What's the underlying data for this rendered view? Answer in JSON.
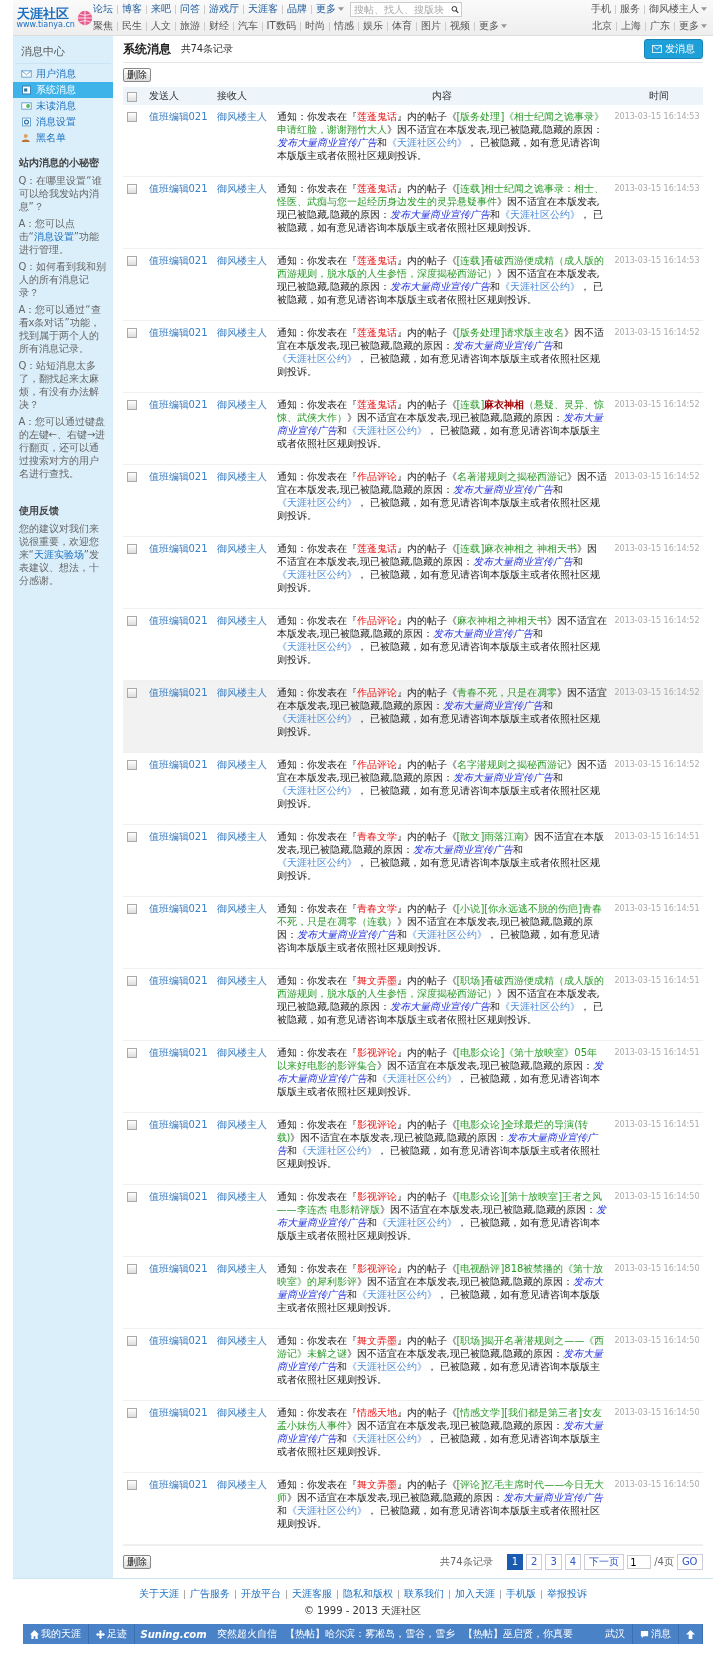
{
  "header": {
    "logo": {
      "title": "天涯社区",
      "url": "www.tianya.cn"
    },
    "nav_primary": [
      {
        "label": "论坛",
        "dropdown": false
      },
      {
        "label": "博客",
        "dropdown": false
      },
      {
        "label": "来吧",
        "dropdown": false
      },
      {
        "label": "问答",
        "dropdown": false
      },
      {
        "label": "游戏厅",
        "dropdown": false
      },
      {
        "label": "天涯客",
        "dropdown": false
      },
      {
        "label": "品牌",
        "dropdown": false
      },
      {
        "label": "更多",
        "dropdown": true
      }
    ],
    "search": {
      "placeholder": "搜帖、找人、搜版块"
    },
    "user_links": [
      {
        "label": "手机",
        "dropdown": false
      },
      {
        "label": "服务",
        "dropdown": false
      },
      {
        "label": "御风楼主人",
        "dropdown": true
      }
    ],
    "nav_secondary": [
      {
        "label": "聚焦",
        "dropdown": false
      },
      {
        "label": "民生",
        "dropdown": false
      },
      {
        "label": "人文",
        "dropdown": false
      },
      {
        "label": "旅游",
        "dropdown": false
      },
      {
        "label": "财经",
        "dropdown": false
      },
      {
        "label": "汽车",
        "dropdown": false
      },
      {
        "label": "IT数码",
        "dropdown": false
      },
      {
        "label": "时尚",
        "dropdown": false
      },
      {
        "label": "情感",
        "dropdown": false
      },
      {
        "label": "娱乐",
        "dropdown": false
      },
      {
        "label": "体育",
        "dropdown": false
      },
      {
        "label": "图片",
        "dropdown": false
      },
      {
        "label": "视频",
        "dropdown": false
      },
      {
        "label": "更多",
        "dropdown": true
      }
    ],
    "city_links": [
      {
        "label": "北京",
        "dropdown": false
      },
      {
        "label": "上海",
        "dropdown": false
      },
      {
        "label": "广东",
        "dropdown": false
      },
      {
        "label": "更多",
        "dropdown": true
      }
    ]
  },
  "sidebar": {
    "title": "消息中心",
    "items": [
      {
        "label": "用户消息",
        "kind": "mail",
        "selected": false
      },
      {
        "label": "系统消息",
        "kind": "system",
        "selected": true
      },
      {
        "label": "未读消息",
        "kind": "unread",
        "selected": false
      },
      {
        "label": "消息设置",
        "kind": "settings",
        "selected": false
      },
      {
        "label": "黑名单",
        "kind": "blacklist",
        "selected": false
      }
    ],
    "tips_title": "站内消息的小秘密",
    "tips": [
      [
        {
          "kind": "text",
          "text": "Q：在哪里设置“谁可以给我发站内消息”？"
        }
      ],
      [
        {
          "kind": "text",
          "text": "A：您可以点击“"
        },
        {
          "kind": "link",
          "text": "消息设置"
        },
        {
          "kind": "text",
          "text": "”功能进行管理。"
        }
      ],
      [
        {
          "kind": "text",
          "text": "Q：如何看到我和别人的所有消息记录？"
        }
      ],
      [
        {
          "kind": "text",
          "text": "A：您可以通过“查看x条对话”功能，找到属于两个人的所有消息记录。"
        }
      ],
      [
        {
          "kind": "text",
          "text": "Q：站短消息太多了，翻找起来太麻烦，有没有办法解决？"
        }
      ],
      [
        {
          "kind": "text",
          "text": "A：您可以通过键盘的左键←、右键→进行翻页，还可以通过搜索对方的用户名进行查找。"
        }
      ]
    ],
    "feedback_title": "使用反馈",
    "feedback": [
      {
        "kind": "text",
        "text": "您的建议对我们来说很重要，欢迎您来“"
      },
      {
        "kind": "link",
        "text": "天涯实验场"
      },
      {
        "kind": "text",
        "text": "”发表建议、想法，十分感谢。"
      }
    ]
  },
  "main": {
    "title": "系统消息",
    "count": "共74条记录",
    "compose_button": "发消息",
    "delete_button": "删除",
    "table": {
      "select_all_checked": false,
      "columns": [
        "发送人",
        "接收人",
        "内容",
        "时间"
      ],
      "rows": [
        {
          "checked": false,
          "highlighted": false,
          "sender": "值班编辑021",
          "receiver": "御风楼主人",
          "time": "2013-03-15 16:14:53",
          "notice": [
            {
              "kind": "plain",
              "text": "通知：你发表在『"
            },
            {
              "kind": "board",
              "text": "莲蓬鬼话"
            },
            {
              "kind": "plain",
              "text": "』内的帖子《"
            },
            {
              "kind": "post",
              "text": "[版务处理]《相士纪闻之诡事录》申请红脸，谢谢翔竹大人"
            },
            {
              "kind": "plain",
              "text": "》因不适宜在本版发表,现已被隐藏,隐藏的原因："
            },
            {
              "kind": "reason",
              "text": "发布大量商业宣传广告"
            },
            {
              "kind": "plain",
              "text": "和"
            },
            {
              "kind": "rule",
              "text": "《天涯社区公约》"
            },
            {
              "kind": "plain",
              "text": "， 已被隐藏，如有意见请咨询本版版主或者依照社区规则投诉。"
            }
          ]
        },
        {
          "checked": false,
          "highlighted": false,
          "sender": "值班编辑021",
          "receiver": "御风楼主人",
          "time": "2013-03-15 16:14:53",
          "notice": [
            {
              "kind": "plain",
              "text": "通知：你发表在『"
            },
            {
              "kind": "board",
              "text": "莲蓬鬼话"
            },
            {
              "kind": "plain",
              "text": "』内的帖子《"
            },
            {
              "kind": "post",
              "text": "[连载]相士纪闻之诡事录：相士、怪医、武痴与您一起经历身边发生的灵异悬疑事件"
            },
            {
              "kind": "plain",
              "text": "》因不适宜在本版发表,现已被隐藏,隐藏的原因："
            },
            {
              "kind": "reason",
              "text": "发布大量商业宣传广告"
            },
            {
              "kind": "plain",
              "text": "和"
            },
            {
              "kind": "rule",
              "text": "《天涯社区公约》"
            },
            {
              "kind": "plain",
              "text": "， 已被隐藏，如有意见请咨询本版版主或者依照社区规则投诉。"
            }
          ]
        },
        {
          "checked": false,
          "highlighted": false,
          "sender": "值班编辑021",
          "receiver": "御风楼主人",
          "time": "2013-03-15 16:14:53",
          "notice": [
            {
              "kind": "plain",
              "text": "通知：你发表在『"
            },
            {
              "kind": "board",
              "text": "莲蓬鬼话"
            },
            {
              "kind": "plain",
              "text": "』内的帖子《"
            },
            {
              "kind": "post",
              "text": "[连载]看破西游便成精（成人版的西游规则，脱水版的人生参悟，深度揭秘西游记）"
            },
            {
              "kind": "plain",
              "text": "》因不适宜在本版发表,现已被隐藏,隐藏的原因："
            },
            {
              "kind": "reason",
              "text": "发布大量商业宣传广告"
            },
            {
              "kind": "plain",
              "text": "和"
            },
            {
              "kind": "rule",
              "text": "《天涯社区公约》"
            },
            {
              "kind": "plain",
              "text": "， 已被隐藏，如有意见请咨询本版版主或者依照社区规则投诉。"
            }
          ]
        },
        {
          "checked": false,
          "highlighted": false,
          "sender": "值班编辑021",
          "receiver": "御风楼主人",
          "time": "2013-03-15 16:14:52",
          "notice": [
            {
              "kind": "plain",
              "text": "通知：你发表在『"
            },
            {
              "kind": "board",
              "text": "莲蓬鬼话"
            },
            {
              "kind": "plain",
              "text": "』内的帖子《"
            },
            {
              "kind": "post",
              "text": "[版务处理]请求版主改名"
            },
            {
              "kind": "plain",
              "text": "》因不适宜在本版发表,现已被隐藏,隐藏的原因："
            },
            {
              "kind": "reason",
              "text": "发布大量商业宣传广告"
            },
            {
              "kind": "plain",
              "text": "和"
            },
            {
              "kind": "rule",
              "text": "《天涯社区公约》"
            },
            {
              "kind": "plain",
              "text": "， 已被隐藏，如有意见请咨询本版版主或者依照社区规则投诉。"
            }
          ]
        },
        {
          "checked": false,
          "highlighted": false,
          "sender": "值班编辑021",
          "receiver": "御风楼主人",
          "time": "2013-03-15 16:14:52",
          "notice": [
            {
              "kind": "plain",
              "text": "通知：你发表在『"
            },
            {
              "kind": "board",
              "text": "莲蓬鬼话"
            },
            {
              "kind": "plain",
              "text": "』内的帖子《"
            },
            {
              "kind": "post",
              "text": "[连载]"
            },
            {
              "kind": "highlight",
              "text": "麻衣神相"
            },
            {
              "kind": "post",
              "text": "（悬疑、灵异、惊悚、武侠大作）"
            },
            {
              "kind": "plain",
              "text": "》因不适宜在本版发表,现已被隐藏,隐藏的原因："
            },
            {
              "kind": "reason",
              "text": "发布大量商业宣传广告"
            },
            {
              "kind": "plain",
              "text": "和"
            },
            {
              "kind": "rule",
              "text": "《天涯社区公约》"
            },
            {
              "kind": "plain",
              "text": "， 已被隐藏，如有意见请咨询本版版主或者依照社区规则投诉。"
            }
          ]
        },
        {
          "checked": false,
          "highlighted": false,
          "sender": "值班编辑021",
          "receiver": "御风楼主人",
          "time": "2013-03-15 16:14:52",
          "notice": [
            {
              "kind": "plain",
              "text": "通知：你发表在『"
            },
            {
              "kind": "board",
              "text": "作品评论"
            },
            {
              "kind": "plain",
              "text": "』内的帖子《"
            },
            {
              "kind": "post",
              "text": "名著潜规则之揭秘西游记"
            },
            {
              "kind": "plain",
              "text": "》因不适宜在本版发表,现已被隐藏,隐藏的原因："
            },
            {
              "kind": "reason",
              "text": "发布大量商业宣传广告"
            },
            {
              "kind": "plain",
              "text": "和"
            },
            {
              "kind": "rule",
              "text": "《天涯社区公约》"
            },
            {
              "kind": "plain",
              "text": "， 已被隐藏，如有意见请咨询本版版主或者依照社区规则投诉。"
            }
          ]
        },
        {
          "checked": false,
          "highlighted": false,
          "sender": "值班编辑021",
          "receiver": "御风楼主人",
          "time": "2013-03-15 16:14:52",
          "notice": [
            {
              "kind": "plain",
              "text": "通知：你发表在『"
            },
            {
              "kind": "board",
              "text": "莲蓬鬼话"
            },
            {
              "kind": "plain",
              "text": "』内的帖子《"
            },
            {
              "kind": "post",
              "text": "[连载]麻衣神相之 神相天书"
            },
            {
              "kind": "plain",
              "text": "》因不适宜在本版发表,现已被隐藏,隐藏的原因："
            },
            {
              "kind": "reason",
              "text": "发布大量商业宣传广告"
            },
            {
              "kind": "plain",
              "text": "和"
            },
            {
              "kind": "rule",
              "text": "《天涯社区公约》"
            },
            {
              "kind": "plain",
              "text": "， 已被隐藏，如有意见请咨询本版版主或者依照社区规则投诉。"
            }
          ]
        },
        {
          "checked": false,
          "highlighted": false,
          "sender": "值班编辑021",
          "receiver": "御风楼主人",
          "time": "2013-03-15 16:14:52",
          "notice": [
            {
              "kind": "plain",
              "text": "通知：你发表在『"
            },
            {
              "kind": "board",
              "text": "作品评论"
            },
            {
              "kind": "plain",
              "text": "』内的帖子《"
            },
            {
              "kind": "post",
              "text": "麻衣神相之神相天书"
            },
            {
              "kind": "plain",
              "text": "》因不适宜在本版发表,现已被隐藏,隐藏的原因："
            },
            {
              "kind": "reason",
              "text": "发布大量商业宣传广告"
            },
            {
              "kind": "plain",
              "text": "和"
            },
            {
              "kind": "rule",
              "text": "《天涯社区公约》"
            },
            {
              "kind": "plain",
              "text": "， 已被隐藏，如有意见请咨询本版版主或者依照社区规则投诉。"
            }
          ]
        },
        {
          "checked": false,
          "highlighted": true,
          "sender": "值班编辑021",
          "receiver": "御风楼主人",
          "time": "2013-03-15 16:14:52",
          "notice": [
            {
              "kind": "plain",
              "text": "通知：你发表在『"
            },
            {
              "kind": "board",
              "text": "作品评论"
            },
            {
              "kind": "plain",
              "text": "』内的帖子《"
            },
            {
              "kind": "post",
              "text": "青春不死，只是在凋零"
            },
            {
              "kind": "plain",
              "text": "》因不适宜在本版发表,现已被隐藏,隐藏的原因："
            },
            {
              "kind": "reason",
              "text": "发布大量商业宣传广告"
            },
            {
              "kind": "plain",
              "text": "和"
            },
            {
              "kind": "rule",
              "text": "《天涯社区公约》"
            },
            {
              "kind": "plain",
              "text": "， 已被隐藏，如有意见请咨询本版版主或者依照社区规则投诉。"
            }
          ]
        },
        {
          "checked": false,
          "highlighted": false,
          "sender": "值班编辑021",
          "receiver": "御风楼主人",
          "time": "2013-03-15 16:14:52",
          "notice": [
            {
              "kind": "plain",
              "text": "通知：你发表在『"
            },
            {
              "kind": "board",
              "text": "作品评论"
            },
            {
              "kind": "plain",
              "text": "』内的帖子《"
            },
            {
              "kind": "post",
              "text": "名字潜规则之揭秘西游记"
            },
            {
              "kind": "plain",
              "text": "》因不适宜在本版发表,现已被隐藏,隐藏的原因："
            },
            {
              "kind": "reason",
              "text": "发布大量商业宣传广告"
            },
            {
              "kind": "plain",
              "text": "和"
            },
            {
              "kind": "rule",
              "text": "《天涯社区公约》"
            },
            {
              "kind": "plain",
              "text": "， 已被隐藏，如有意见请咨询本版版主或者依照社区规则投诉。"
            }
          ]
        },
        {
          "checked": false,
          "highlighted": false,
          "sender": "值班编辑021",
          "receiver": "御风楼主人",
          "time": "2013-03-15 16:14:51",
          "notice": [
            {
              "kind": "plain",
              "text": "通知：你发表在『"
            },
            {
              "kind": "board",
              "text": "青春文学"
            },
            {
              "kind": "plain",
              "text": "』内的帖子《"
            },
            {
              "kind": "post",
              "text": "[散文]雨落江南"
            },
            {
              "kind": "plain",
              "text": "》因不适宜在本版发表,现已被隐藏,隐藏的原因："
            },
            {
              "kind": "reason",
              "text": "发布大量商业宣传广告"
            },
            {
              "kind": "plain",
              "text": "和"
            },
            {
              "kind": "rule",
              "text": "《天涯社区公约》"
            },
            {
              "kind": "plain",
              "text": "， 已被隐藏，如有意见请咨询本版版主或者依照社区规则投诉。"
            }
          ]
        },
        {
          "checked": false,
          "highlighted": false,
          "sender": "值班编辑021",
          "receiver": "御风楼主人",
          "time": "2013-03-15 16:14:51",
          "notice": [
            {
              "kind": "plain",
              "text": "通知：你发表在『"
            },
            {
              "kind": "board",
              "text": "青春文学"
            },
            {
              "kind": "plain",
              "text": "』内的帖子《"
            },
            {
              "kind": "post",
              "text": "[小说][你永远逃不脱的伤疤]青春不死，只是在凋零（连载）"
            },
            {
              "kind": "plain",
              "text": "》因不适宜在本版发表,现已被隐藏,隐藏的原因："
            },
            {
              "kind": "reason",
              "text": "发布大量商业宣传广告"
            },
            {
              "kind": "plain",
              "text": "和"
            },
            {
              "kind": "rule",
              "text": "《天涯社区公约》"
            },
            {
              "kind": "plain",
              "text": "， 已被隐藏，如有意见请咨询本版版主或者依照社区规则投诉。"
            }
          ]
        },
        {
          "checked": false,
          "highlighted": false,
          "sender": "值班编辑021",
          "receiver": "御风楼主人",
          "time": "2013-03-15 16:14:51",
          "notice": [
            {
              "kind": "plain",
              "text": "通知：你发表在『"
            },
            {
              "kind": "board",
              "text": "舞文弄墨"
            },
            {
              "kind": "plain",
              "text": "』内的帖子《"
            },
            {
              "kind": "post",
              "text": "[职场]看破西游便成精（成人版的西游规则，脱水版的人生参悟，深度揭秘西游记）"
            },
            {
              "kind": "plain",
              "text": "》因不适宜在本版发表,现已被隐藏,隐藏的原因："
            },
            {
              "kind": "reason",
              "text": "发布大量商业宣传广告"
            },
            {
              "kind": "plain",
              "text": "和"
            },
            {
              "kind": "rule",
              "text": "《天涯社区公约》"
            },
            {
              "kind": "plain",
              "text": "， 已被隐藏，如有意见请咨询本版版主或者依照社区规则投诉。"
            }
          ]
        },
        {
          "checked": false,
          "highlighted": false,
          "sender": "值班编辑021",
          "receiver": "御风楼主人",
          "time": "2013-03-15 16:14:51",
          "notice": [
            {
              "kind": "plain",
              "text": "通知：你发表在『"
            },
            {
              "kind": "board",
              "text": "影视评论"
            },
            {
              "kind": "plain",
              "text": "』内的帖子《"
            },
            {
              "kind": "post",
              "text": "[电影众论]《第十放映室》05年以来好电影的影评集合"
            },
            {
              "kind": "plain",
              "text": "》因不适宜在本版发表,现已被隐藏,隐藏的原因："
            },
            {
              "kind": "reason",
              "text": "发布大量商业宣传广告"
            },
            {
              "kind": "plain",
              "text": "和"
            },
            {
              "kind": "rule",
              "text": "《天涯社区公约》"
            },
            {
              "kind": "plain",
              "text": "， 已被隐藏，如有意见请咨询本版版主或者依照社区规则投诉。"
            }
          ]
        },
        {
          "checked": false,
          "highlighted": false,
          "sender": "值班编辑021",
          "receiver": "御风楼主人",
          "time": "2013-03-15 16:14:51",
          "notice": [
            {
              "kind": "plain",
              "text": "通知：你发表在『"
            },
            {
              "kind": "board",
              "text": "影视评论"
            },
            {
              "kind": "plain",
              "text": "』内的帖子《"
            },
            {
              "kind": "post",
              "text": "[电影众论]全球最烂的导演(转载)"
            },
            {
              "kind": "plain",
              "text": "》因不适宜在本版发表,现已被隐藏,隐藏的原因："
            },
            {
              "kind": "reason",
              "text": "发布大量商业宣传广告"
            },
            {
              "kind": "plain",
              "text": "和"
            },
            {
              "kind": "rule",
              "text": "《天涯社区公约》"
            },
            {
              "kind": "plain",
              "text": "， 已被隐藏，如有意见请咨询本版版主或者依照社区规则投诉。"
            }
          ]
        },
        {
          "checked": false,
          "highlighted": false,
          "sender": "值班编辑021",
          "receiver": "御风楼主人",
          "time": "2013-03-15 16:14:50",
          "notice": [
            {
              "kind": "plain",
              "text": "通知：你发表在『"
            },
            {
              "kind": "board",
              "text": "影视评论"
            },
            {
              "kind": "plain",
              "text": "』内的帖子《"
            },
            {
              "kind": "post",
              "text": "[电影众论][第十放映室]王者之风——李连杰 电影精评版"
            },
            {
              "kind": "plain",
              "text": "》因不适宜在本版发表,现已被隐藏,隐藏的原因："
            },
            {
              "kind": "reason",
              "text": "发布大量商业宣传广告"
            },
            {
              "kind": "plain",
              "text": "和"
            },
            {
              "kind": "rule",
              "text": "《天涯社区公约》"
            },
            {
              "kind": "plain",
              "text": "， 已被隐藏，如有意见请咨询本版版主或者依照社区规则投诉。"
            }
          ]
        },
        {
          "checked": false,
          "highlighted": false,
          "sender": "值班编辑021",
          "receiver": "御风楼主人",
          "time": "2013-03-15 16:14:50",
          "notice": [
            {
              "kind": "plain",
              "text": "通知：你发表在『"
            },
            {
              "kind": "board",
              "text": "影视评论"
            },
            {
              "kind": "plain",
              "text": "』内的帖子《"
            },
            {
              "kind": "post",
              "text": "[电视酷评]818被禁播的《第十放映室》的犀利影评"
            },
            {
              "kind": "plain",
              "text": "》因不适宜在本版发表,现已被隐藏,隐藏的原因："
            },
            {
              "kind": "reason",
              "text": "发布大量商业宣传广告"
            },
            {
              "kind": "plain",
              "text": "和"
            },
            {
              "kind": "rule",
              "text": "《天涯社区公约》"
            },
            {
              "kind": "plain",
              "text": "， 已被隐藏，如有意见请咨询本版版主或者依照社区规则投诉。"
            }
          ]
        },
        {
          "checked": false,
          "highlighted": false,
          "sender": "值班编辑021",
          "receiver": "御风楼主人",
          "time": "2013-03-15 16:14:50",
          "notice": [
            {
              "kind": "plain",
              "text": "通知：你发表在『"
            },
            {
              "kind": "board",
              "text": "舞文弄墨"
            },
            {
              "kind": "plain",
              "text": "』内的帖子《"
            },
            {
              "kind": "post",
              "text": "[职场]揭开名著潜规则之——《西游记》未解之谜"
            },
            {
              "kind": "plain",
              "text": "》因不适宜在本版发表,现已被隐藏,隐藏的原因："
            },
            {
              "kind": "reason",
              "text": "发布大量商业宣传广告"
            },
            {
              "kind": "plain",
              "text": "和"
            },
            {
              "kind": "rule",
              "text": "《天涯社区公约》"
            },
            {
              "kind": "plain",
              "text": "， 已被隐藏，如有意见请咨询本版版主或者依照社区规则投诉。"
            }
          ]
        },
        {
          "checked": false,
          "highlighted": false,
          "sender": "值班编辑021",
          "receiver": "御风楼主人",
          "time": "2013-03-15 16:14:50",
          "notice": [
            {
              "kind": "plain",
              "text": "通知：你发表在『"
            },
            {
              "kind": "board",
              "text": "情感天地"
            },
            {
              "kind": "plain",
              "text": "』内的帖子《"
            },
            {
              "kind": "post",
              "text": "[情感文学][我们都是第三者]女友孟小妹伤人事件"
            },
            {
              "kind": "plain",
              "text": "》因不适宜在本版发表,现已被隐藏,隐藏的原因："
            },
            {
              "kind": "reason",
              "text": "发布大量商业宣传广告"
            },
            {
              "kind": "plain",
              "text": "和"
            },
            {
              "kind": "rule",
              "text": "《天涯社区公约》"
            },
            {
              "kind": "plain",
              "text": "， 已被隐藏，如有意见请咨询本版版主或者依照社区规则投诉。"
            }
          ]
        },
        {
          "checked": false,
          "highlighted": false,
          "sender": "值班编辑021",
          "receiver": "御风楼主人",
          "time": "2013-03-15 16:14:50",
          "notice": [
            {
              "kind": "plain",
              "text": "通知：你发表在『"
            },
            {
              "kind": "board",
              "text": "舞文弄墨"
            },
            {
              "kind": "plain",
              "text": "』内的帖子《"
            },
            {
              "kind": "post",
              "text": "[评论]忆毛主席时代——今日无大师"
            },
            {
              "kind": "plain",
              "text": "》因不适宜在本版发表,现已被隐藏,隐藏的原因："
            },
            {
              "kind": "reason",
              "text": "发布大量商业宣传广告"
            },
            {
              "kind": "plain",
              "text": "和"
            },
            {
              "kind": "rule",
              "text": "《天涯社区公约》"
            },
            {
              "kind": "plain",
              "text": "， 已被隐藏，如有意见请咨询本版版主或者依照社区规则投诉。"
            }
          ]
        }
      ]
    },
    "bottom_delete_button": "删除",
    "bottom_count": "共74条记录",
    "pagination": {
      "pages": [
        {
          "label": "1",
          "selected": true
        },
        {
          "label": "2",
          "selected": false
        },
        {
          "label": "3",
          "selected": false
        },
        {
          "label": "4",
          "selected": false
        }
      ],
      "next": "下一页",
      "page_input": "1",
      "total": "/4页",
      "go": "GO"
    }
  },
  "footer": {
    "links": [
      "关于天涯",
      "广告服务",
      "开放平台",
      "天涯客服",
      "隐私和版权",
      "联系我们",
      "加入天涯",
      "手机版",
      "举报投诉"
    ],
    "copyright": "© 1999 - 2013 天涯社区"
  },
  "bottom_bar": {
    "items": [
      {
        "kind": "home",
        "label": "我的天涯"
      },
      {
        "kind": "footprint",
        "label": "足迹"
      },
      {
        "kind": "brand",
        "label": "Suning.com"
      },
      {
        "kind": "news",
        "label": "突然超火自信"
      },
      {
        "kind": "news",
        "label": "【热帖】哈尔滨：雾凇岛，雪谷，雪乡"
      },
      {
        "kind": "news",
        "label": "【热帖】巫启贤，你真要"
      }
    ],
    "right": [
      {
        "kind": "city",
        "label": "武汉"
      },
      {
        "kind": "message",
        "label": "消息"
      },
      {
        "kind": "top"
      }
    ]
  }
}
